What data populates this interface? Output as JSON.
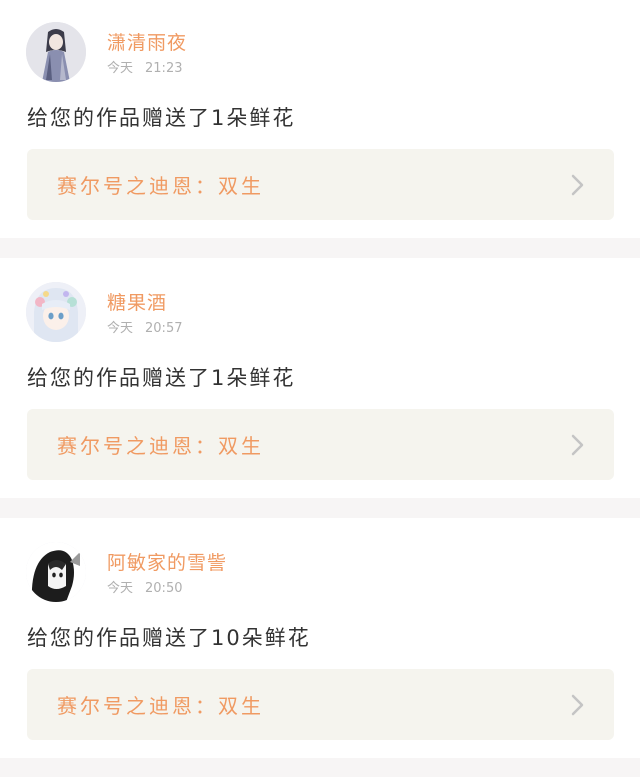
{
  "notifications": [
    {
      "username": "潇清雨夜",
      "day": "今天",
      "time": "21:23",
      "message": "给您的作品赠送了1朵鲜花",
      "work_title": "赛尔号之迪恩：双生"
    },
    {
      "username": "糖果酒",
      "day": "今天",
      "time": "20:57",
      "message": "给您的作品赠送了1朵鲜花",
      "work_title": "赛尔号之迪恩：双生"
    },
    {
      "username": "阿敏家的雪訾",
      "day": "今天",
      "time": "20:50",
      "message": "给您的作品赠送了10朵鲜花",
      "work_title": "赛尔号之迪恩：双生"
    }
  ],
  "colors": {
    "accent": "#f09a62",
    "text": "#333333",
    "muted": "#b0b0b0",
    "link_bg": "#f5f4ee",
    "divider_bg": "#f7f5f5"
  }
}
